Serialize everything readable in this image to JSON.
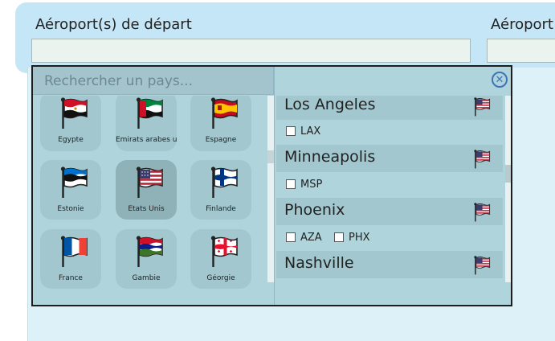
{
  "form": {
    "departure_label": "Aéroport(s) de départ",
    "arrival_label": "Aéroport"
  },
  "picker": {
    "search_placeholder": "Rechercher un pays...",
    "close_symbol": "✕",
    "countries": [
      {
        "name": "Égypte",
        "flag": "egypt-flag-icon"
      },
      {
        "name": "Émirats arabes u",
        "flag": "uae-flag-icon"
      },
      {
        "name": "Espagne",
        "flag": "spain-flag-icon"
      },
      {
        "name": "Estonie",
        "flag": "estonia-flag-icon"
      },
      {
        "name": "États Unis",
        "flag": "usa-flag-icon",
        "selected": true
      },
      {
        "name": "Finlande",
        "flag": "finland-flag-icon"
      },
      {
        "name": "France",
        "flag": "france-flag-icon"
      },
      {
        "name": "Gambie",
        "flag": "gambia-flag-icon"
      },
      {
        "name": "Géorgie",
        "flag": "georgia-flag-icon"
      }
    ],
    "cities": [
      {
        "name": "Los Angeles",
        "flag": "usa-flag-icon",
        "airports": [
          "LAX"
        ]
      },
      {
        "name": "Minneapolis",
        "flag": "usa-flag-icon",
        "airports": [
          "MSP"
        ]
      },
      {
        "name": "Phoenix",
        "flag": "usa-flag-icon",
        "airports": [
          "AZA",
          "PHX"
        ]
      },
      {
        "name": "Nashville",
        "flag": "usa-flag-icon",
        "airports": []
      }
    ]
  }
}
